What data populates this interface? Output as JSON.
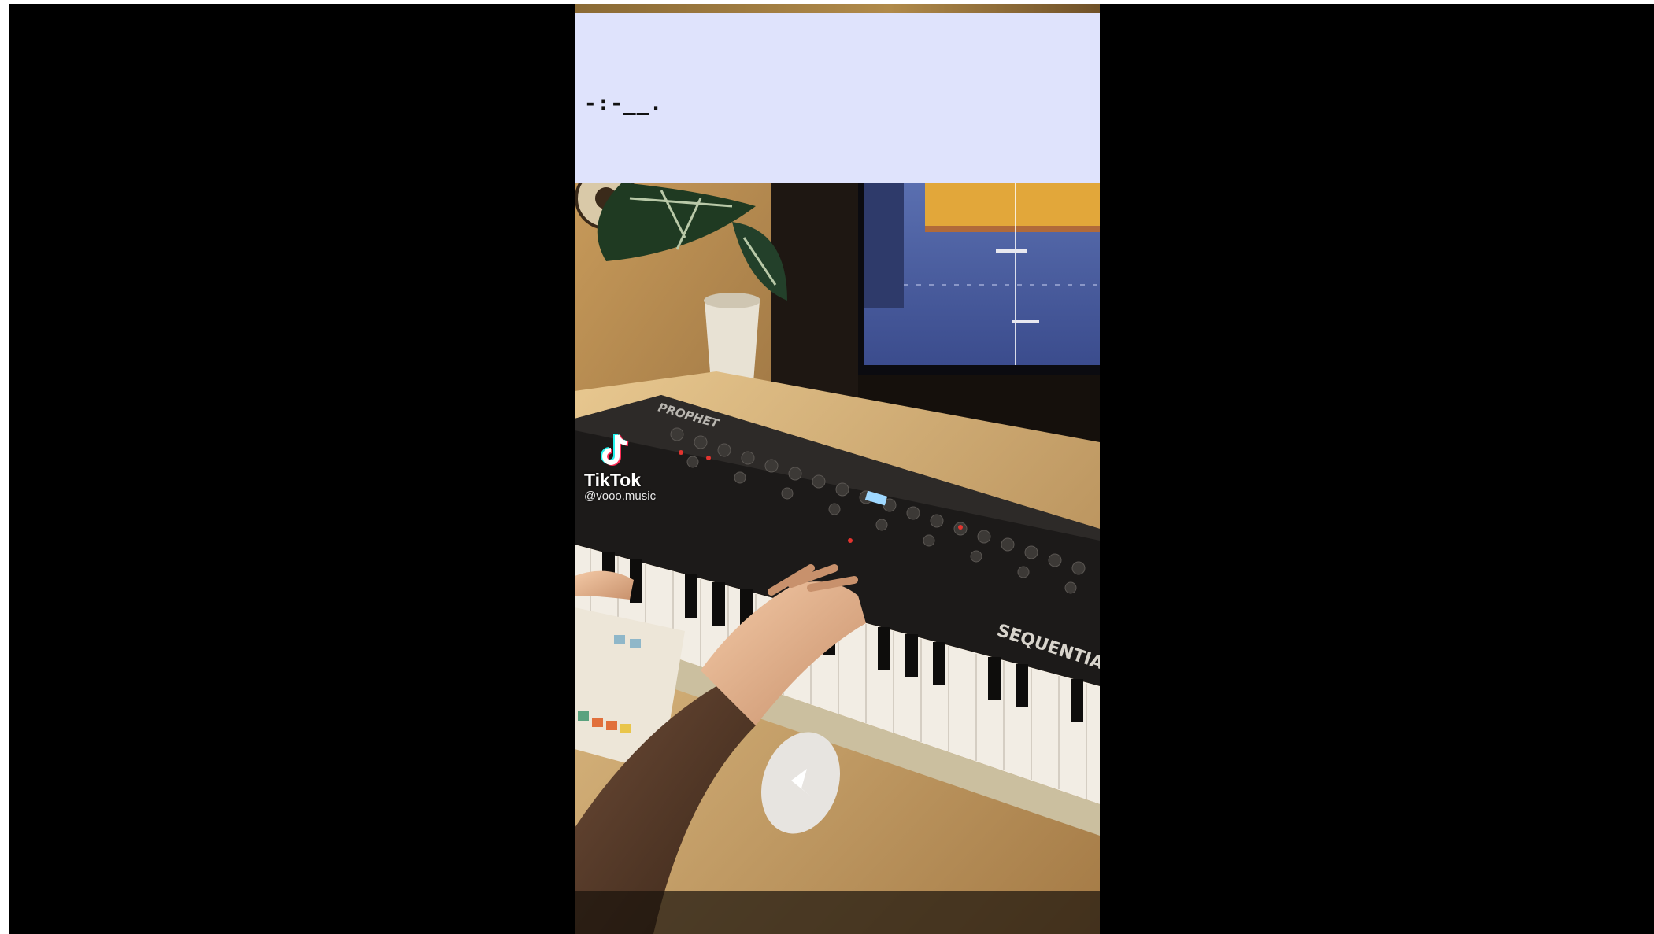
{
  "caption": {
    "text": "-:-__."
  },
  "watermark": {
    "brand": "TikTok",
    "handle": "@vooo.music",
    "logo_icon": "tiktok-note-icon"
  },
  "instrument": {
    "brand": "PROPHET",
    "model": "SEQUENTIAL"
  },
  "colors": {
    "caption_bg": "#dfe3fc",
    "frame_bg": "#000000",
    "tiktok_cyan": "#25f4ee",
    "tiktok_red": "#fe2c55"
  }
}
